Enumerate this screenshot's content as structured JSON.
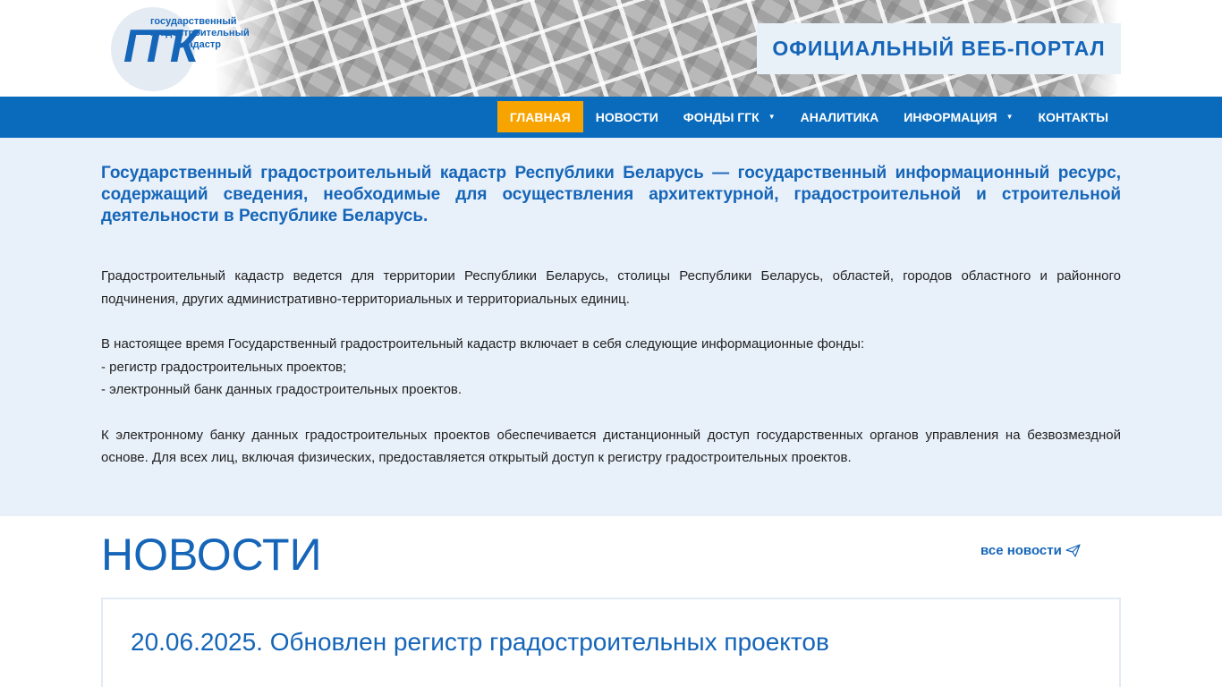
{
  "header": {
    "logo": {
      "letters": "ГГК",
      "line1": "государственный",
      "line2": "градостроительный",
      "line3": "кадастр"
    },
    "portal_title": "ОФИЦИАЛЬНЫЙ ВЕБ-ПОРТАЛ"
  },
  "nav": {
    "items": [
      {
        "label": "ГЛАВНАЯ",
        "active": true
      },
      {
        "label": "НОВОСТИ"
      },
      {
        "label": "ФОНДЫ ГГК",
        "has_submenu": true
      },
      {
        "label": "АНАЛИТИКА"
      },
      {
        "label": "ИНФОРМАЦИЯ",
        "has_submenu": true
      },
      {
        "label": "КОНТАКТЫ"
      }
    ]
  },
  "intro": {
    "lead": "Государственный градостроительный кадастр Республики Беларусь — государственный информационный ресурс, содержащий сведения, необходимые для осуществления архитектурной, градостроительной и строительной деятельности в Республике Беларусь.",
    "p1": "Градостроительный кадастр ведется для территории Республики Беларусь, столицы Республики Беларусь, областей, городов областного и районного подчинения, других административно-территориальных и территориальных единиц.",
    "p2_line1": "В настоящее время Государственный градостроительный кадастр включает в себя следующие информационные фонды:",
    "p2_line2": "- регистр градостроительных проектов;",
    "p2_line3": "- электронный банк данных градостроительных проектов.",
    "p3": "К электронному банку данных градостроительных проектов обеспечивается дистанционный доступ государственных органов управления на безвозмездной основе. Для всех лиц, включая физических, предоставляется открытый доступ к регистру градостроительных проектов."
  },
  "news": {
    "heading": "НОВОСТИ",
    "all_news": "все новости",
    "items": [
      {
        "title": "20.06.2025. Обновлен регистр градостроительных проектов"
      }
    ]
  },
  "colors": {
    "brand_blue": "#1565b8",
    "nav_blue": "#0a6bbd",
    "active_orange": "#f7a400",
    "intro_bg": "#e8f0f9"
  }
}
